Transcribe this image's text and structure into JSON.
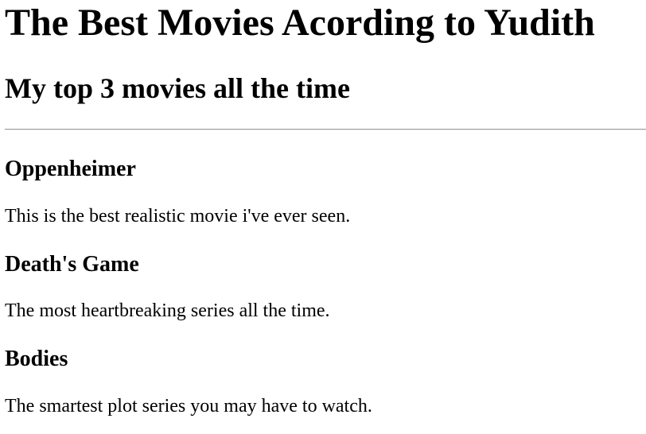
{
  "page": {
    "title": "The Best Movies Acording to Yudith",
    "subtitle": "My top 3 movies all the time"
  },
  "movies": [
    {
      "title": "Oppenheimer",
      "description": "This is the best realistic movie i've ever seen."
    },
    {
      "title": "Death's Game",
      "description": "The most heartbreaking series all the time."
    },
    {
      "title": "Bodies",
      "description": "The smartest plot series you may have to watch."
    }
  ]
}
